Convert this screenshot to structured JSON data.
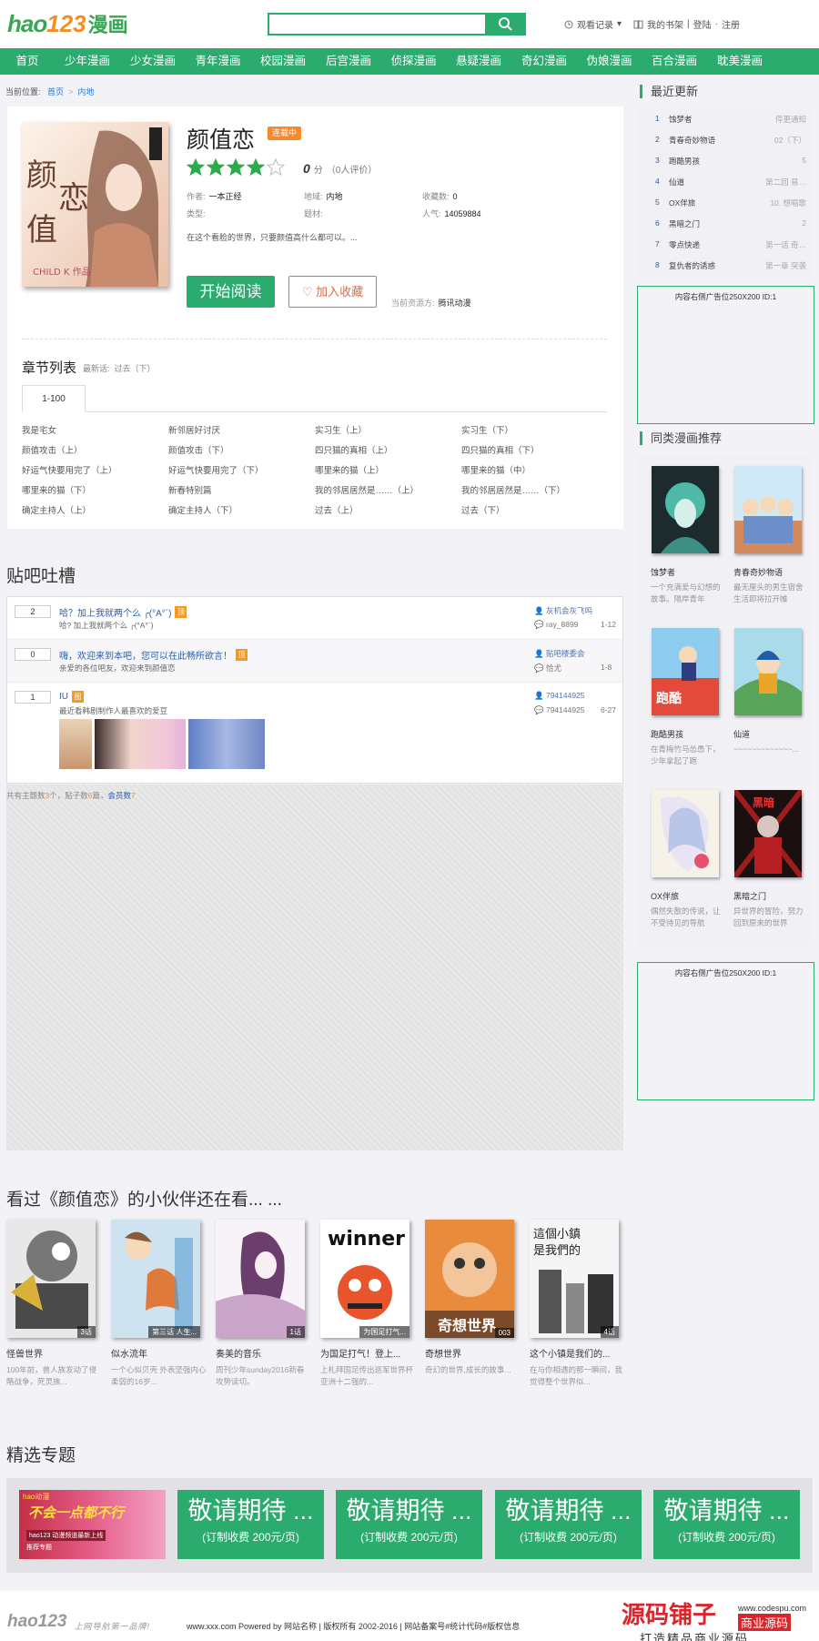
{
  "header": {
    "logo": {
      "part1": "hao",
      "part2": "123",
      "part3": "漫画"
    },
    "search": {
      "placeholder": ""
    },
    "history": "观看记录",
    "shelf": "我的书架",
    "login": "登陆",
    "register": "注册"
  },
  "nav": [
    "首页",
    "少年漫画",
    "少女漫画",
    "青年漫画",
    "校园漫画",
    "后宫漫画",
    "侦探漫画",
    "悬疑漫画",
    "奇幻漫画",
    "伪娘漫画",
    "百合漫画",
    "耽美漫画"
  ],
  "breadcrumb": {
    "label": "当前位置:",
    "home": "首页",
    "cat": "内地"
  },
  "comic": {
    "title": "颜值恋",
    "status": "连载中",
    "score": "0",
    "score_unit": "分",
    "raters": "（0人评价）",
    "rating_stars": 4,
    "author_label": "作者:",
    "author": "一本正经",
    "region_label": "地域:",
    "region": "内地",
    "fav_label": "收藏数:",
    "fav": "0",
    "type_label": "类型:",
    "type": "",
    "theme_label": "题材:",
    "theme": "",
    "pop_label": "人气:",
    "pop": "14059884",
    "desc": "在这个看脸的世界，只要颜值高什么都可以。...",
    "read_btn": "开始阅读",
    "fav_btn": "加入收藏",
    "source_label": "当前资源方:",
    "source": "腾讯动漫",
    "cover_text": {
      "main": "颜值恋",
      "logo": "CHILD K 作品"
    }
  },
  "chapters": {
    "heading": "章节列表",
    "latest_label": "最新话:",
    "latest": "过去（下）",
    "tab": "1-100",
    "items": [
      "我是宅女",
      "新邻居好讨厌",
      "实习生（上）",
      "实习生（下）",
      "颜值攻击（上）",
      "颜值攻击（下）",
      "四只猫的真相（上）",
      "四只猫的真相（下）",
      "好运气快要用完了（上）",
      "好运气快要用完了（下）",
      "哪里来的猫（上）",
      "哪里来的猫（中）",
      "哪里来的猫（下）",
      "新春特别篇",
      "我的邻居居然是……（上）",
      "我的邻居居然是……（下）",
      "确定主持人（上）",
      "确定主持人（下）",
      "过去（上）",
      "过去（下）"
    ]
  },
  "forum": {
    "heading": "贴吧吐槽",
    "posts": [
      {
        "count": "2",
        "title": "哈？加上我就两个么 ╭(°A°`)",
        "icon": "顶",
        "summary": "哈? 加上我就两个么 ╭(°A°`)",
        "author": "灰机会灰飞呜",
        "last": "ray_8899",
        "date": "1-12"
      },
      {
        "count": "0",
        "title": "嗨，欢迎来到本吧，您可以在此畅所欲言！",
        "icon": "顶",
        "summary": "亲爱的各位吧友，欢迎来到颜值恋",
        "author": "贴吧楼委会",
        "last": "恰尤",
        "date": "1-8"
      },
      {
        "count": "1",
        "title": "IU",
        "icon": "图",
        "summary": "最近看韩剧制作人最喜欢的爱豆",
        "author": "794144925",
        "last": "794144925",
        "date": "6-27"
      }
    ],
    "stats": {
      "p1": "共有主题数",
      "topics": "3",
      "p2": "个，贴子数",
      "posts": "6",
      "p3": "篇，",
      "members_label": "会员数",
      "members": "7"
    }
  },
  "sidebar": {
    "recent_heading": "最近更新",
    "recent": [
      {
        "n": "1",
        "t": "蚀梦者",
        "c": "停更通知"
      },
      {
        "n": "2",
        "t": "青春奇妙物语",
        "c": "02（下）"
      },
      {
        "n": "3",
        "t": "跑酷男孩",
        "c": "5"
      },
      {
        "n": "4",
        "t": "仙道",
        "c": "第二回 易…"
      },
      {
        "n": "5",
        "t": "OX伴旅",
        "c": "10. 想唱歌"
      },
      {
        "n": "6",
        "t": "黑暗之门",
        "c": "2"
      },
      {
        "n": "7",
        "t": "零点快递",
        "c": "第一话 奇…"
      },
      {
        "n": "8",
        "t": "复仇者的诱惑",
        "c": "第一章 突袭"
      }
    ],
    "ad": "内容右侧广告位250X200 ID:1",
    "similar_heading": "同类漫画推荐",
    "similar": [
      {
        "name": "蚀梦者",
        "desc": "一个充满爱与幻想的故事。隔岸青年"
      },
      {
        "name": "青春奇妙物语",
        "desc": "最无厘头的男生宿舍生活即将拉开帷"
      },
      {
        "name": "跑酷男孩",
        "desc": "在青梅竹马怂恿下，少年拿起了跑"
      },
      {
        "name": "仙道",
        "desc": "~~~~~~~~~~~~~..."
      },
      {
        "name": "OX伴旅",
        "desc": "偶然失散的传说，让不受待见的导航"
      },
      {
        "name": "黑暗之门",
        "desc": "异世界的冒险，努力回到原来的世界"
      }
    ]
  },
  "also": {
    "heading": "看过《颜值恋》的小伙伴还在看... ...",
    "items": [
      {
        "name": "怪兽世界",
        "desc": "100年前，兽人族发动了侵略战争，死灵族...",
        "tag": "3话"
      },
      {
        "name": "似水流年",
        "desc": "一个心似贝壳 外表坚强内心柔弱的16岁...",
        "tag": "第三话 人生..."
      },
      {
        "name": "奏美的音乐",
        "desc": "周刊少年sunday2016新春攻势读切。",
        "tag": "1话"
      },
      {
        "name": "为国足打气！登上...",
        "desc": "上札拜国足传出巡军世界杯亚洲十二强的...",
        "tag": "为国足打气..."
      },
      {
        "name": "奇想世界",
        "desc": "奇幻的世界,成长的故事...",
        "tag": "003"
      },
      {
        "name": "这个小镇是我们的...",
        "desc": "在与你相遇的那一瞬间，我觉得整个世界似...",
        "tag": "4话"
      }
    ]
  },
  "topics": {
    "heading": "精选专题",
    "banner1": {
      "t1": "hao动漫",
      "t2": "不会一点都不行",
      "t3": "hao123 动漫频道最新上线",
      "t4": "推荐专题"
    },
    "placeholder": {
      "a": "敬请期待 ...",
      "b": "(订制收费 200元/页)"
    }
  },
  "footer": {
    "logo": "hao123",
    "slogan": "上网导航第一品牌!",
    "text": "www.xxx.com Powered by 网站名称 | 版权所有 2002-2016 | 网站备案号#统计代码#版权信息"
  },
  "watermark": {
    "main": "源码铺子",
    "url": "www.codespu.com",
    "tag": "商业源码",
    "sub": "打造精品商业源码"
  }
}
